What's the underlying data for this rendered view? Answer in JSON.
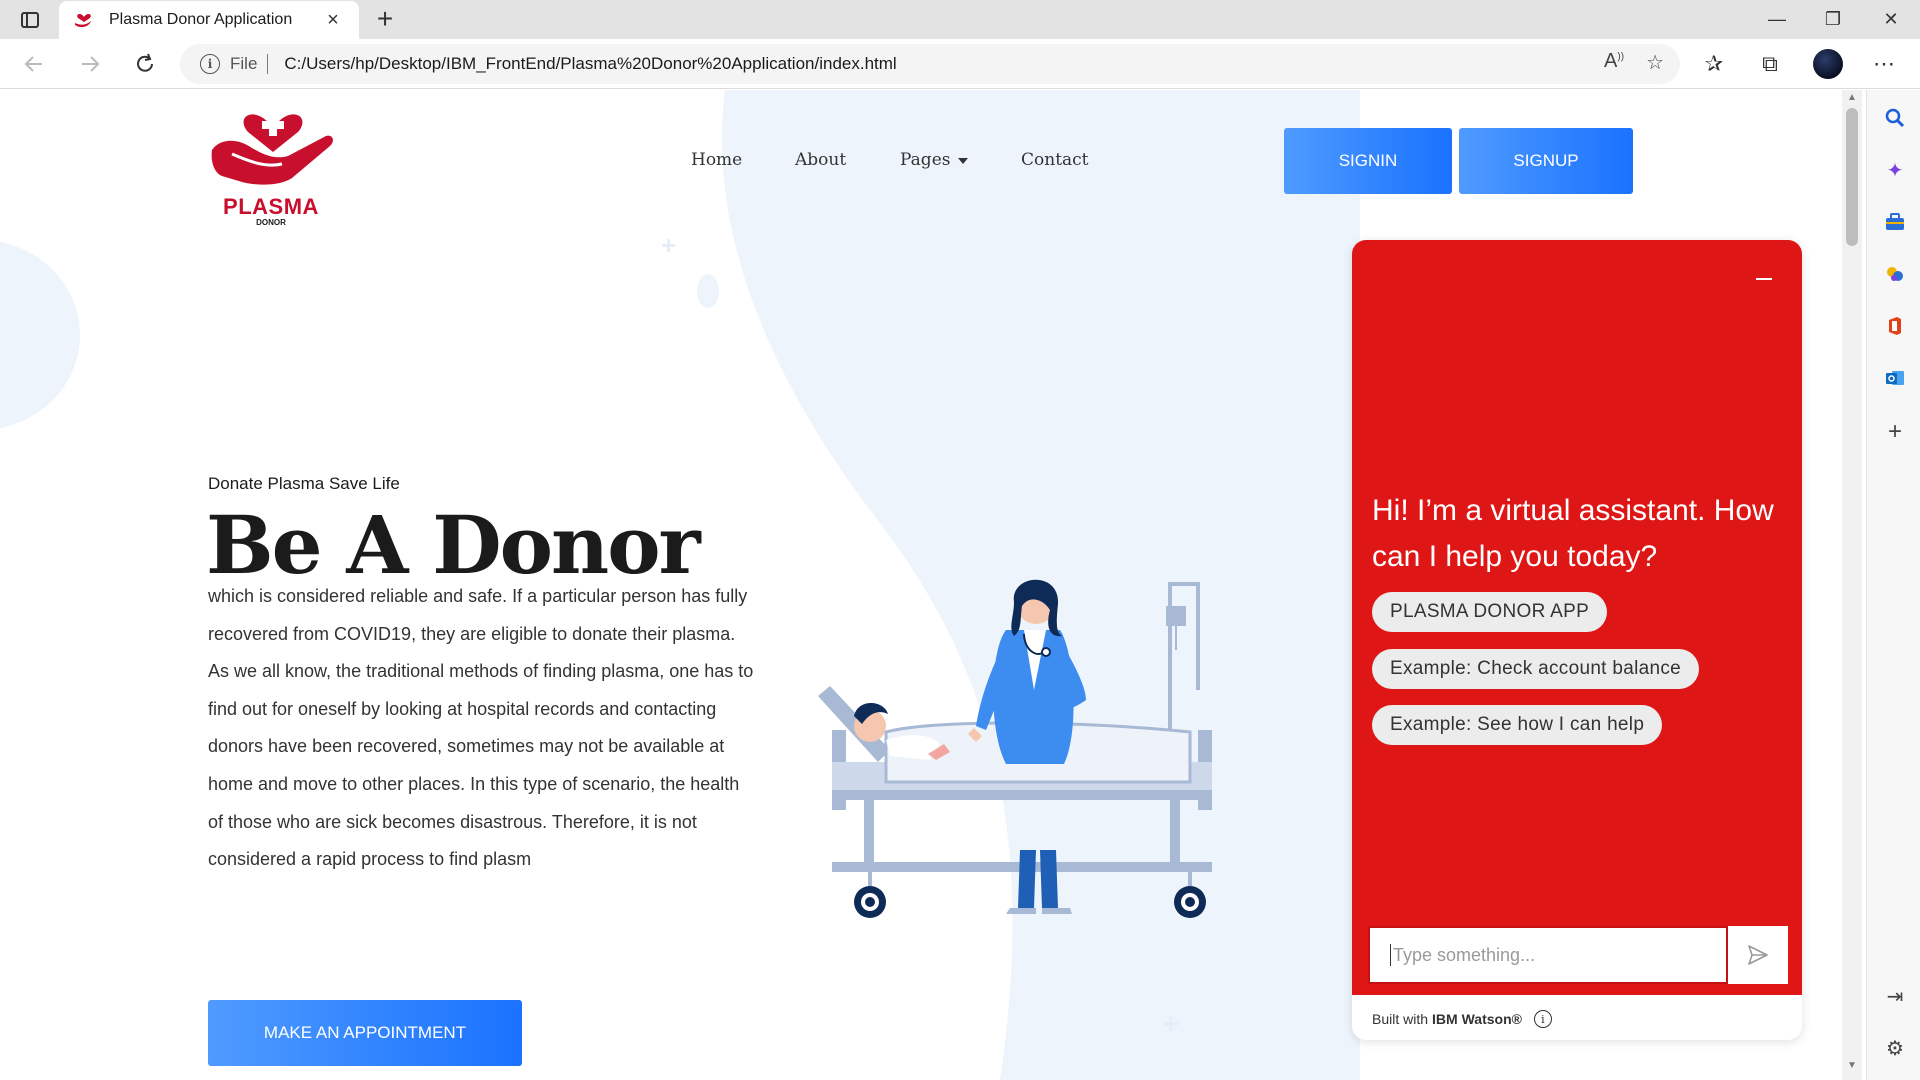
{
  "browser": {
    "tab_title": "Plasma Donor Application",
    "tab_close": "×",
    "new_tab": "+",
    "url_scheme_label": "File",
    "url": "C:/Users/hp/Desktop/IBM_FrontEnd/Plasma%20Donor%20Application/index.html",
    "window_controls": {
      "minimize": "—",
      "restore": "❐",
      "close": "✕"
    }
  },
  "site": {
    "logo_text": "PLASMA",
    "logo_subtext": "DONOR",
    "nav": {
      "home": "Home",
      "about": "About",
      "pages": "Pages",
      "contact": "Contact"
    },
    "auth": {
      "signin": "SIGNIN",
      "signup": "SIGNUP"
    },
    "hero": {
      "subtitle": "Donate Plasma Save Life",
      "title": "Be A Donor",
      "body": "which is considered reliable and safe. If a particular person has fully recovered from COVID19, they are eligible to donate their plasma. As we all know, the traditional methods of finding plasma, one has to find out for oneself by looking at hospital records and contacting donors have been recovered, sometimes may not be available at home and move to other places. In this type of scenario, the health of those who are sick becomes disastrous. Therefore, it is not considered a rapid process to find plasm",
      "cta": "MAKE AN APPOINTMENT"
    }
  },
  "chat": {
    "greeting": "Hi! I’m a virtual assistant. How can I help you today?",
    "chips": [
      "PLASMA DONOR APP",
      "Example: Check account balance",
      "Example: See how I can help"
    ],
    "input_placeholder": "Type something...",
    "footer_prefix": "Built with",
    "footer_brand": "IBM Watson®",
    "footer_info": "i"
  },
  "colors": {
    "brand_red": "#c8102e",
    "chat_red": "#df1616",
    "button_blue": "#1a72ff"
  }
}
